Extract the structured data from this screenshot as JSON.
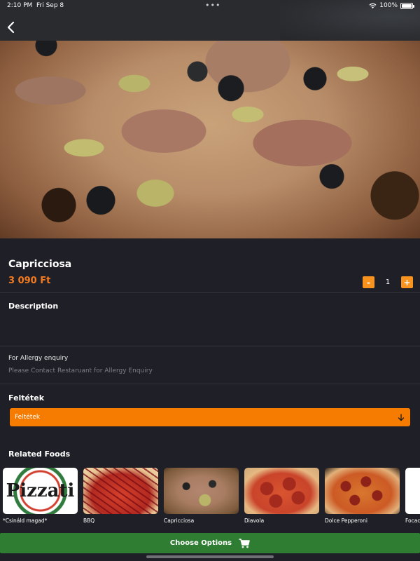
{
  "status_bar": {
    "time": "2:10 PM",
    "date": "Fri Sep 8",
    "dots": "•••",
    "battery": "100%"
  },
  "product": {
    "name": "Capricciosa",
    "price": "3 090 Ft",
    "quantity": "1",
    "minus": "-",
    "plus": "+"
  },
  "description": {
    "label": "Description"
  },
  "allergy": {
    "title": "For Allergy enquiry",
    "text": "Please Contact Restaruant for Allergy Enquiry"
  },
  "conditions": {
    "label": "Feltétek",
    "selected": "Feltétek"
  },
  "related": {
    "label": "Related Foods",
    "items": [
      {
        "name": "*Csináld magad*",
        "logo_text": "Pizzati"
      },
      {
        "name": "BBQ"
      },
      {
        "name": "Capricciosa"
      },
      {
        "name": "Diavola"
      },
      {
        "name": "Dolce Pepperoni"
      },
      {
        "name": "Focaccia"
      }
    ]
  },
  "cta": {
    "label": "Choose Options",
    "icon": "cart-icon"
  },
  "colors": {
    "background": "#1f2027",
    "accent": "#f57c00",
    "price": "#f47a20",
    "cta": "#2e7d32"
  }
}
